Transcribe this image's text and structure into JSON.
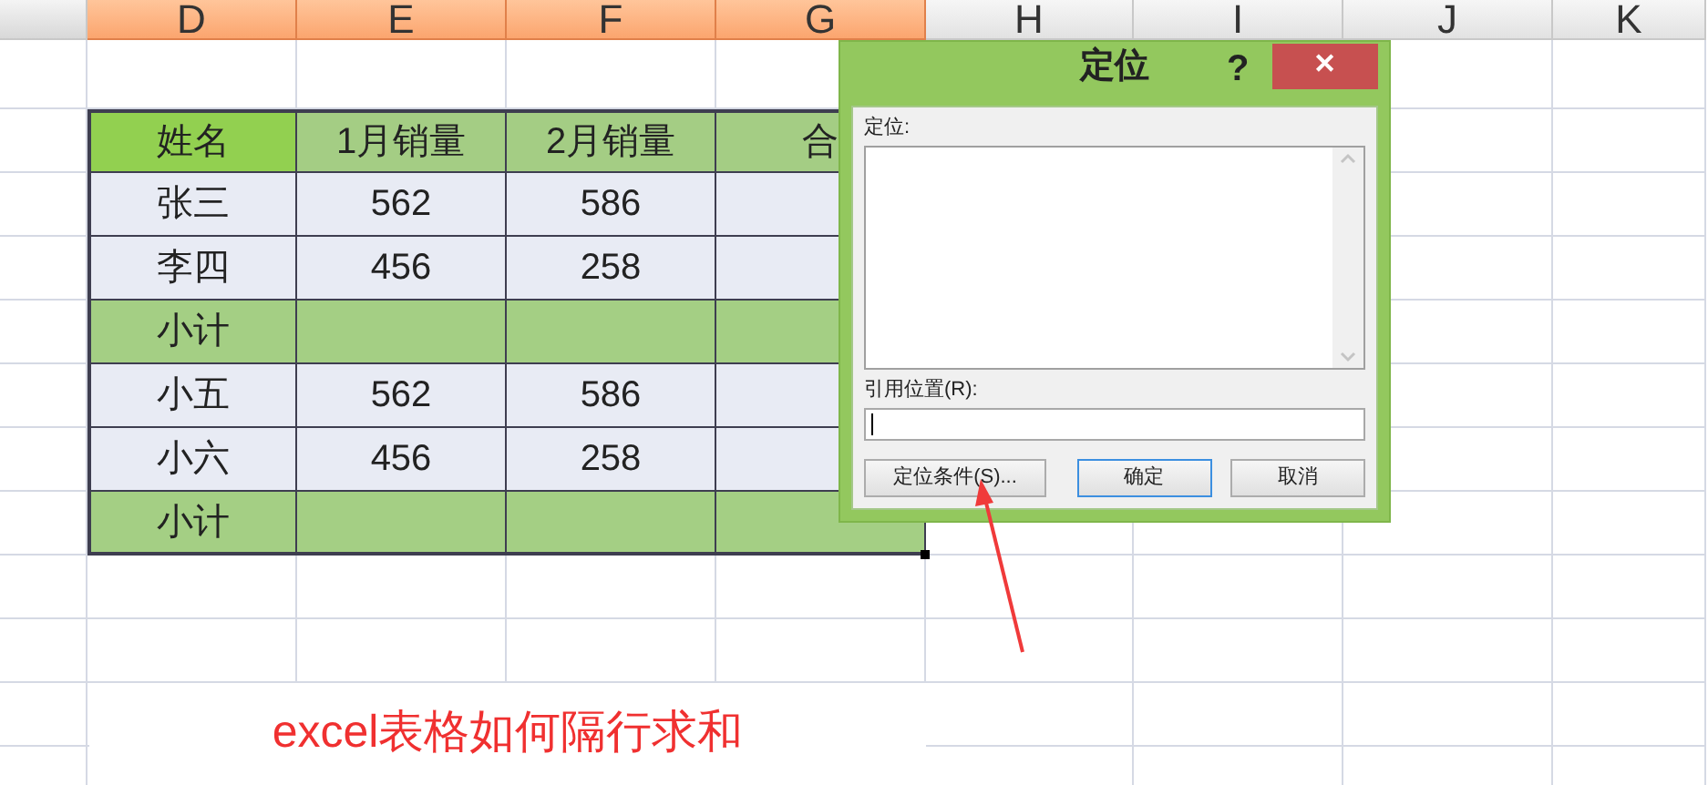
{
  "sheet": {
    "columns": [
      {
        "label": "D",
        "selected": true
      },
      {
        "label": "E",
        "selected": true
      },
      {
        "label": "F",
        "selected": true
      },
      {
        "label": "G",
        "selected": true
      },
      {
        "label": "H",
        "selected": false
      },
      {
        "label": "I",
        "selected": false
      },
      {
        "label": "J",
        "selected": false
      },
      {
        "label": "K",
        "selected": false
      }
    ]
  },
  "table": {
    "columns": [
      "姓名",
      "1月销量",
      "2月销量",
      "合"
    ],
    "rows": [
      {
        "kind": "data",
        "cells": [
          "张三",
          "562",
          "586"
        ]
      },
      {
        "kind": "data",
        "cells": [
          "李四",
          "456",
          "258"
        ]
      },
      {
        "kind": "subtotal",
        "cells": [
          "小计"
        ]
      },
      {
        "kind": "data",
        "cells": [
          "小五",
          "562",
          "586"
        ]
      },
      {
        "kind": "data",
        "cells": [
          "小六",
          "456",
          "258"
        ]
      },
      {
        "kind": "subtotal",
        "cells": [
          "小计"
        ]
      }
    ]
  },
  "dialog": {
    "title": "定位",
    "help": "?",
    "close": "✕",
    "list_label": "定位:",
    "reference_label": "引用位置(R):",
    "buttons": [
      {
        "label": "定位条件(S)...",
        "default": false
      },
      {
        "label": "确定",
        "default": true
      },
      {
        "label": "取消",
        "default": false
      }
    ]
  },
  "caption": "excel表格如何隔行求和"
}
